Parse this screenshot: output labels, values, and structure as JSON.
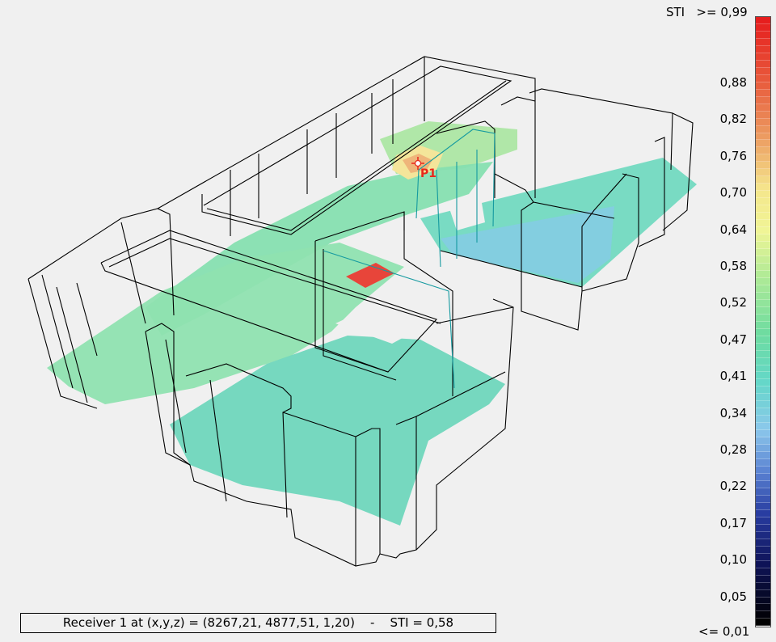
{
  "legend": {
    "title": "STI",
    "top_label": ">= 0,99",
    "bottom_label": "<= 0,01",
    "ticks": [
      "0,88",
      "0,82",
      "0,76",
      "0,70",
      "0,64",
      "0,58",
      "0,52",
      "0,47",
      "0,41",
      "0,34",
      "0,28",
      "0,22",
      "0,17",
      "0,10",
      "0,05"
    ]
  },
  "receiver": {
    "marker_label": "P1",
    "status_text": "Receiver 1 at (x,y,z) = (8267,21, 4877,51, 1,20)    -    STI = 0,58"
  },
  "colors": {
    "high": "#e8271b",
    "mid_yellow": "#f5f08c",
    "mid_green": "#7fdca0",
    "teal": "#6ed6c0",
    "light_blue": "#87c9e6",
    "low": "#000000",
    "marker": "#e8271b"
  }
}
